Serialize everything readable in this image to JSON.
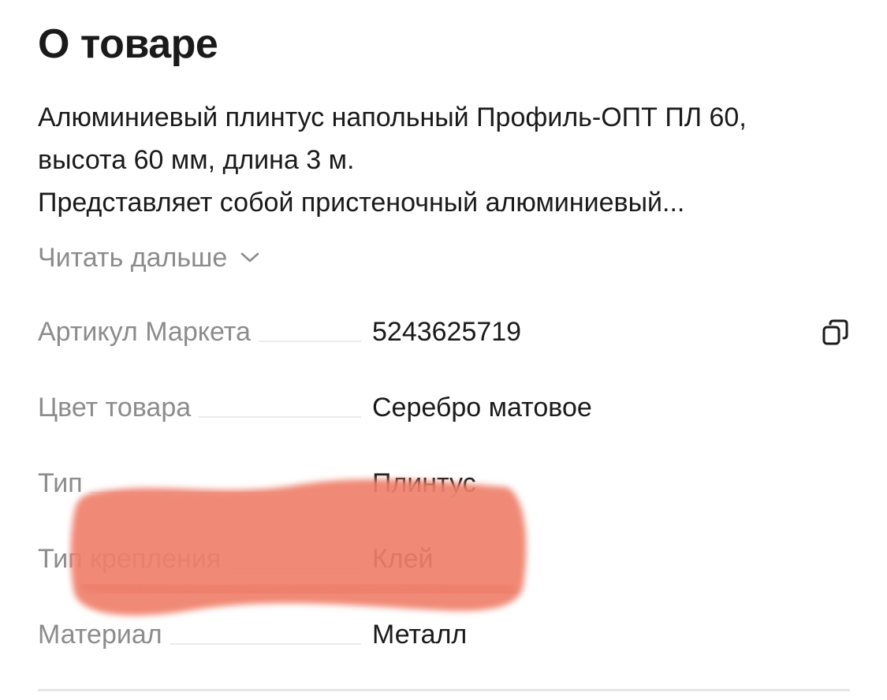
{
  "section": {
    "title": "О товаре",
    "description_lines": [
      "Алюминиевый плинтус напольный Профиль-ОПТ ПЛ 60,",
      "высота 60 мм, длина 3 м.",
      "Представляет собой пристеночный алюминиевый..."
    ],
    "read_more_label": "Читать дальше"
  },
  "specs": [
    {
      "label": "Артикул Маркета",
      "value": "5243625719"
    },
    {
      "label": "Цвет товара",
      "value": "Серебро матовое"
    },
    {
      "label": "Тип",
      "value": "Плинтус"
    },
    {
      "label": "Тип крепления",
      "value": "Клей"
    },
    {
      "label": "Материал",
      "value": "Металл"
    }
  ],
  "icons": {
    "copy": "copy-icon",
    "read_more": "chevron-down-icon"
  },
  "colors": {
    "text_primary": "#1a1a1a",
    "text_secondary": "#8c8c8c",
    "leader_line": "#ececec",
    "redaction_marker": "#ef7f6a"
  }
}
